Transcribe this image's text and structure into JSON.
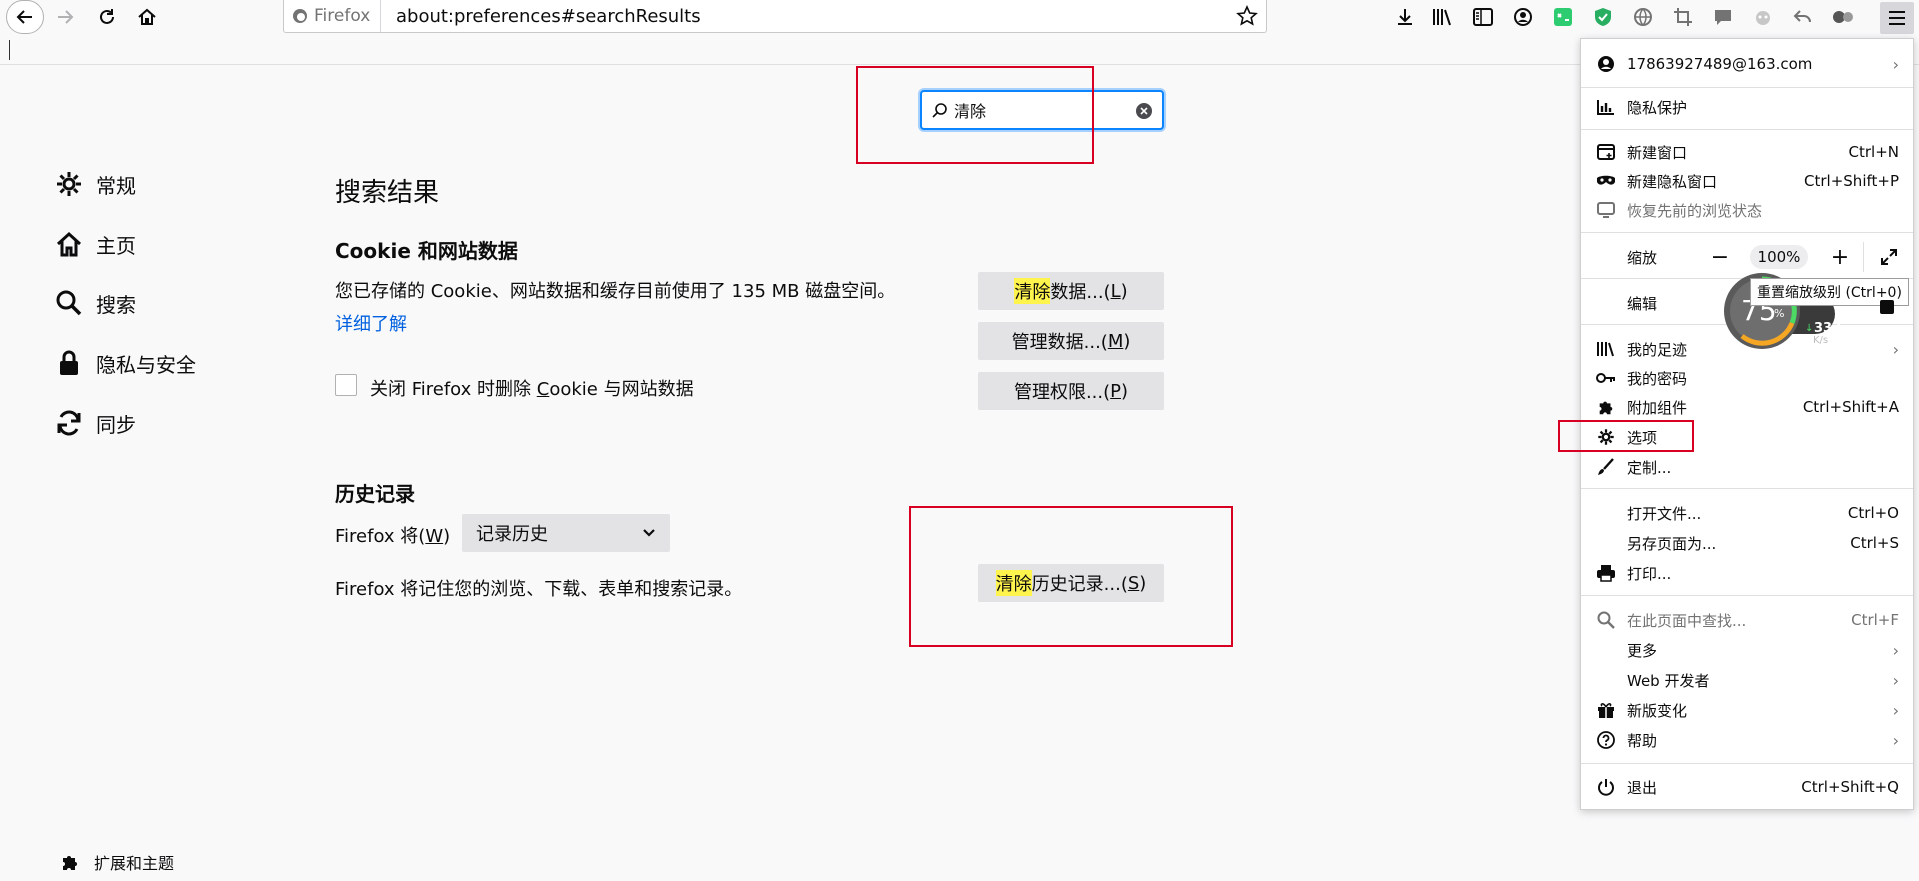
{
  "toolbar": {
    "identity_label": "Firefox",
    "url": "about:preferences#searchResults"
  },
  "search": {
    "value": "清除"
  },
  "sidebar": {
    "items": [
      {
        "label": "常规"
      },
      {
        "label": "主页"
      },
      {
        "label": "搜索"
      },
      {
        "label": "隐私与安全"
      },
      {
        "label": "同步"
      }
    ],
    "extensions_label": "扩展和主题"
  },
  "main": {
    "title": "搜索结果",
    "cookies": {
      "heading": "Cookie 和网站数据",
      "description": "您已存储的 Cookie、网站数据和缓存目前使用了 135 MB 磁盘空间。",
      "learn_more": "详细了解",
      "clear_data": {
        "highlight": "清除",
        "rest": "数据...(",
        "key": "L",
        "end": ")"
      },
      "manage_data": {
        "text": "管理数据...(",
        "key": "M",
        "end": ")"
      },
      "manage_perms": {
        "text": "管理权限...(",
        "key": "P",
        "end": ")"
      },
      "checkbox": {
        "pre": "关闭 Firefox 时删除 ",
        "key": "C",
        "post": "ookie 与网站数据"
      }
    },
    "history": {
      "heading": "历史记录",
      "label_pre": "Firefox 将(",
      "label_key": "W",
      "label_end": ")",
      "select_value": "记录历史",
      "description": "Firefox 将记住您的浏览、下载、表单和搜索记录。",
      "clear_history": {
        "highlight": "清除",
        "rest": "历史记录...(",
        "key": "S",
        "end": ")"
      }
    }
  },
  "app_menu": {
    "account": "17863927489@163.com",
    "privacy": "隐私保护",
    "new_window": {
      "label": "新建窗口",
      "shortcut": "Ctrl+N"
    },
    "new_private": {
      "label": "新建隐私窗口",
      "shortcut": "Ctrl+Shift+P"
    },
    "restore": "恢复先前的浏览状态",
    "zoom": {
      "label": "缩放",
      "level": "100%"
    },
    "edit": "编辑",
    "library": "我的足迹",
    "logins": "我的密码",
    "addons": {
      "label": "附加组件",
      "shortcut": "Ctrl+Shift+A"
    },
    "options": "选项",
    "customize": "定制...",
    "open_file": {
      "label": "打开文件...",
      "shortcut": "Ctrl+O"
    },
    "save_page": {
      "label": "另存页面为...",
      "shortcut": "Ctrl+S"
    },
    "print": "打印...",
    "find": {
      "label": "在此页面中查找...",
      "shortcut": "Ctrl+F"
    },
    "more": "更多",
    "web_dev": "Web 开发者",
    "whats_new": "新版变化",
    "help": "帮助",
    "quit": {
      "label": "退出",
      "shortcut": "Ctrl+Shift+Q"
    }
  },
  "tooltip": "重置缩放级别 (Ctrl+0)",
  "speed_widget": {
    "percent": "75",
    "percent_unit": "%",
    "speed": "333",
    "speed_unit": "K/s"
  },
  "colors": {
    "accent": "#0a84ff",
    "highlight": "#fff34d",
    "annotation": "#d70022"
  }
}
